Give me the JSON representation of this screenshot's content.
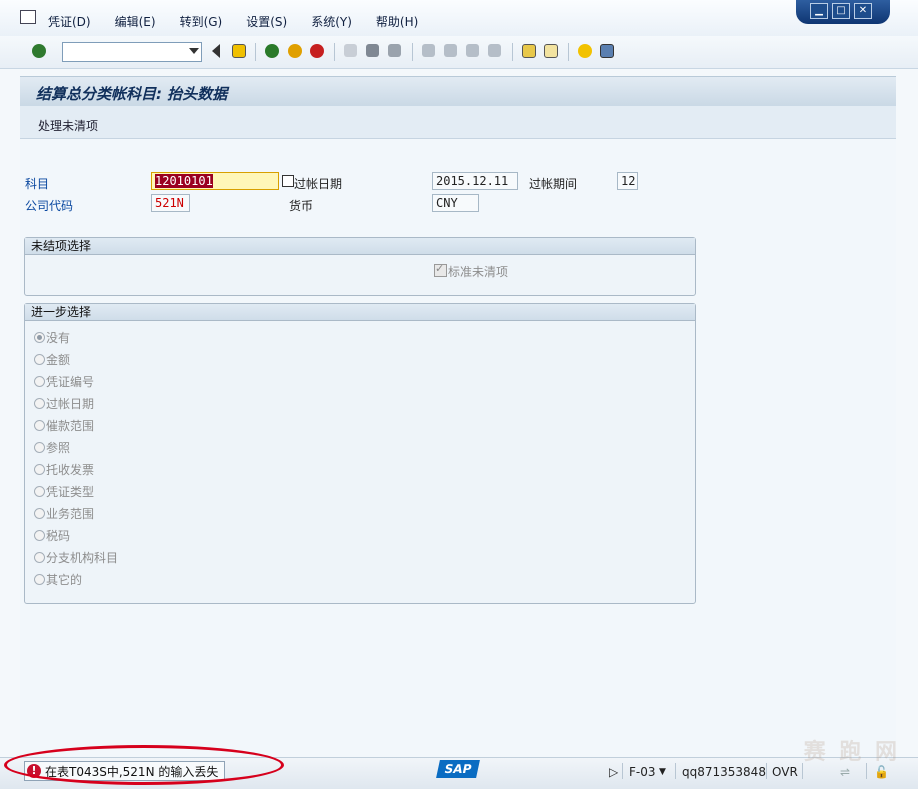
{
  "menu": {
    "items": [
      "凭证(D)",
      "编辑(E)",
      "转到(G)",
      "设置(S)",
      "系统(Y)",
      "帮助(H)"
    ]
  },
  "window_controls": [
    "minimize",
    "maximize",
    "close"
  ],
  "toolbar": {
    "command_value": "",
    "icons": [
      "enter-icon",
      "back-arrow-icon",
      "save-icon",
      "back-icon",
      "exit-icon",
      "cancel-icon",
      "print-icon",
      "find-icon",
      "find-next-icon",
      "first-page-icon",
      "prev-page-icon",
      "next-page-icon",
      "last-page-icon",
      "new-session-icon",
      "shortcut-icon",
      "help-icon",
      "layout-icon"
    ]
  },
  "header": {
    "title": "结算总分类帐科目: 抬头数据",
    "action": "处理未清项"
  },
  "fields": {
    "account_label": "科目",
    "account_value": "12010101",
    "company_label": "公司代码",
    "company_value": "521N",
    "posting_date_label": "过帐日期",
    "posting_date_value": "2015.12.11",
    "period_label": "过帐期间",
    "period_value": "12",
    "currency_label": "货币",
    "currency_value": "CNY"
  },
  "open_items": {
    "title": "未结项选择",
    "checkbox_label": "标准未清项",
    "checked": true
  },
  "further": {
    "title": "进一步选择",
    "options": [
      "没有",
      "金额",
      "凭证编号",
      "过帐日期",
      "催款范围",
      "参照",
      "托收发票",
      "凭证类型",
      "业务范围",
      "税码",
      "分支机构科目",
      "其它的"
    ],
    "selected": "没有"
  },
  "status": {
    "message": "在表T043S中,521N 的输入丢失",
    "transaction": "F-03",
    "server": "qq871353848",
    "mode": "OVR"
  },
  "watermark": "赛 跑 网"
}
